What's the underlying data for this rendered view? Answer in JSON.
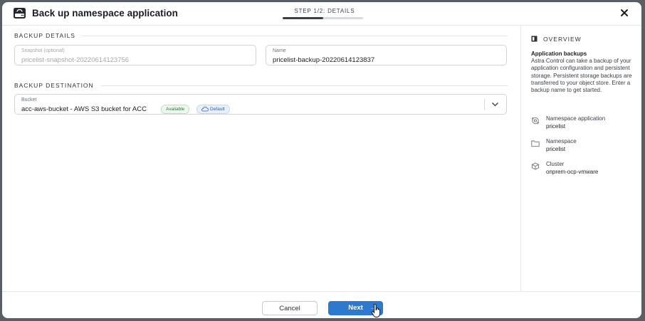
{
  "dialog": {
    "title": "Back up namespace application",
    "step_label": "STEP 1/2: DETAILS",
    "step_progress": 0.5
  },
  "backup_details": {
    "section_title": "BACKUP DETAILS",
    "snapshot": {
      "label": "Snapshot (optional)",
      "value": "pricelist-snapshot-20220614123756"
    },
    "name": {
      "label": "Name",
      "value": "pricelist-backup-20220614123837"
    }
  },
  "backup_destination": {
    "section_title": "BACKUP DESTINATION",
    "bucket": {
      "label": "Bucket",
      "value": "acc-aws-bucket - AWS S3 bucket for ACC",
      "status_badge": "Available",
      "default_badge": "Default"
    }
  },
  "overview": {
    "title": "OVERVIEW",
    "heading": "Application backups",
    "description": "Astra Control can take a backup of your application configuration and persistent storage. Persistent storage backups are transferred to your object store. Enter a backup name to get started.",
    "items": [
      {
        "label": "Namespace application",
        "value": "pricelist",
        "icon": "application-icon"
      },
      {
        "label": "Namespace",
        "value": "pricelist",
        "icon": "folder-icon"
      },
      {
        "label": "Cluster",
        "value": "onprem-ocp-vmware",
        "icon": "cluster-icon"
      }
    ]
  },
  "footer": {
    "cancel_label": "Cancel",
    "next_label": "Next",
    "next_arrow": "→"
  },
  "colors": {
    "primary": "#2d79d0",
    "available_green": "#2b7a36",
    "default_blue": "#2d5fa8"
  }
}
